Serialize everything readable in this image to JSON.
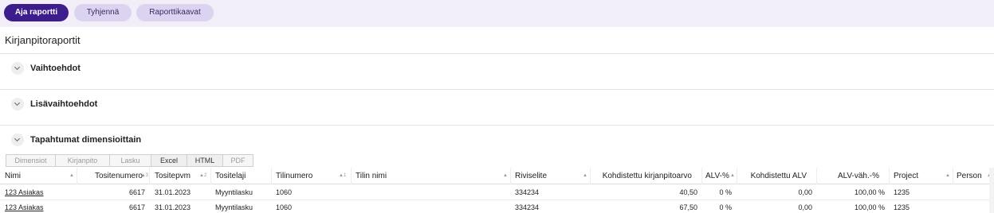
{
  "toolbar": {
    "run_report": "Aja raportti",
    "clear": "Tyhjennä",
    "report_templates": "Raporttikaavat"
  },
  "page": {
    "title": "Kirjanpitoraportit"
  },
  "sections": {
    "options": "Vaihtoehdot",
    "more_options": "Lisävaihtoehdot",
    "dimension_events": "Tapahtumat dimensioittain"
  },
  "export_tabs": [
    "Dimensiot",
    "Kirjanpito",
    "Lasku",
    "Excel",
    "HTML",
    "PDF"
  ],
  "table": {
    "headers": [
      "Nimi",
      "Tositenumero",
      "Tositepvm",
      "Tositelaji",
      "Tilinumero",
      "Tilin nimi",
      "Riviselite",
      "Kohdistettu kirjanpitoarvo",
      "ALV-%",
      "Kohdistettu ALV",
      "ALV-väh.-%",
      "Project",
      "Person"
    ],
    "sort_indicators": [
      "",
      "3",
      "2",
      "",
      "1",
      "",
      "",
      "",
      "",
      "",
      "",
      "",
      ""
    ],
    "rows": [
      [
        "123 Asiakas",
        "6617",
        "31.01.2023",
        "Myyntilasku",
        "1060",
        "",
        "334234",
        "40,50",
        "0 %",
        "0,00",
        "100,00 %",
        "1235",
        ""
      ],
      [
        "123 Asiakas",
        "6617",
        "31.01.2023",
        "Myyntilasku",
        "1060",
        "",
        "334234",
        "67,50",
        "0 %",
        "0,00",
        "100,00 %",
        "1235",
        ""
      ]
    ]
  }
}
